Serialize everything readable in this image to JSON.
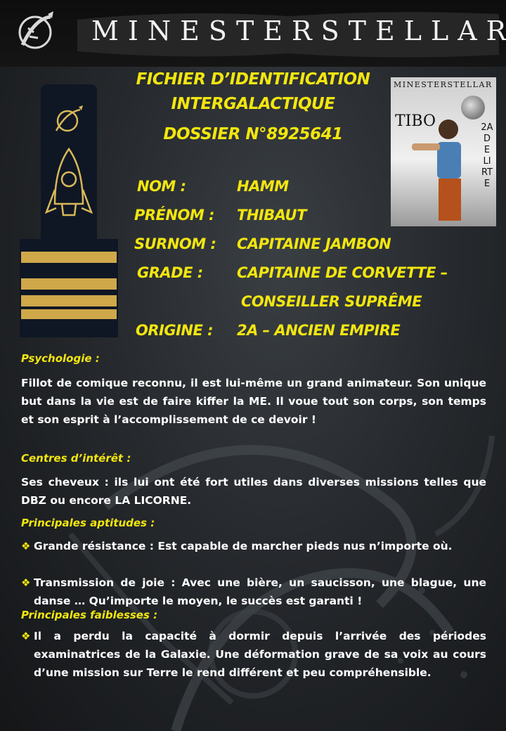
{
  "header": {
    "brand": "MINESTERSTELLAR",
    "logo_icon": "rocket-star-emblem-icon"
  },
  "title": {
    "line1": "FICHIER D’IDENTIFICATION",
    "line2": "INTERGALACTIQUE",
    "dossier": "DOSSIER N°8925641"
  },
  "photo": {
    "brand": "MINESTERSTELLAR",
    "vertical_left": "TIBO",
    "vertical_right": "2A DE LIRTE"
  },
  "fields": [
    {
      "label": "NOM :",
      "value": "HAMM"
    },
    {
      "label": "PRÉNOM :",
      "value": "THIBAUT"
    },
    {
      "label": "SURNOM :",
      "value": "CAPITAINE JAMBON"
    },
    {
      "label": "GRADE :",
      "value": "CAPITAINE DE CORVETTE –",
      "value2": "CONSEILLER SUPRÊME"
    },
    {
      "label": "ORIGINE :",
      "value": "2A – ANCIEN EMPIRE"
    }
  ],
  "sections": {
    "psychologie": {
      "heading": "Psychologie :",
      "text": "Fillot de comique reconnu, il est lui-même un grand animateur. Son unique but dans la vie est de faire kiffer la ME. Il voue tout son corps, son temps et son esprit à l’accomplissement de ce devoir !"
    },
    "interets": {
      "heading": "Centres d’intérêt :",
      "text": "Ses cheveux : ils lui ont été fort utiles dans diverses missions telles que DBZ ou encore LA LICORNE."
    },
    "aptitudes": {
      "heading": "Principales aptitudes :",
      "items": [
        "Grande résistance : Est capable de marcher pieds nus n’importe où.",
        "Transmission de joie : Avec une bière, un saucisson, une blague, une danse … Qu’importe le moyen, le succès est garanti !"
      ]
    },
    "faiblesses": {
      "heading": "Principales faiblesses :",
      "items": [
        "Il a perdu la capacité à dormir depuis l’arrivée des périodes examinatrices de la Galaxie. Une déformation grave de sa voix au cours d’une mission sur Terre le rend différent et peu compréhensible."
      ]
    }
  },
  "colors": {
    "accent": "#f2e60f",
    "text": "#ffffff",
    "background": "#26292d"
  }
}
